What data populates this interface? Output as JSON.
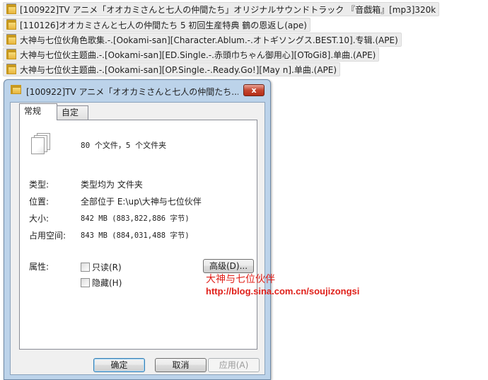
{
  "folders": [
    {
      "label": "[100922]TV アニメ「オオカミさんと七人の仲間たち」オリジナルサウンドトラック 『音戯箱』[mp3]320k"
    },
    {
      "label": "[110126]オオカミさんと七人の仲間たち 5 初回生産特典 鶴の恩返し(ape)"
    },
    {
      "label": "大神与七位伙角色歌集.-.[Ookami-san][Character.Ablum.-.オトギソングス.BEST.10].专辑.(APE)"
    },
    {
      "label": "大神与七位伙主题曲.-.[Ookami-san][ED.Single.-.赤頭巾ちゃん御用心][OToGi8].单曲.(APE)"
    },
    {
      "label": "大神与七位伙主题曲.-.[Ookami-san][OP.Single.-.Ready.Go!][May n].单曲.(APE)"
    }
  ],
  "dialog": {
    "title": "[100922]TV アニメ「オオカミさんと七人の仲間たち...",
    "close_label": "x",
    "tabs": {
      "general": "常规",
      "custom": "自定义"
    },
    "summary": "80 个文件，5 个文件夹",
    "type_label": "类型:",
    "type_value": "类型均为 文件夹",
    "location_label": "位置:",
    "location_value": "全部位于 E:\\up\\大神与七位伙伴",
    "size_label": "大小:",
    "size_value": "842 MB (883,822,886 字节)",
    "disk_label": "占用空间:",
    "disk_value": "843 MB (884,031,488 字节)",
    "attributes_label": "属性:",
    "readonly_label": "只读(R)",
    "hidden_label": "隐藏(H)",
    "advanced_button": "高级(D)...",
    "ok_button": "确定",
    "cancel_button": "取消",
    "apply_button": "应用(A)"
  },
  "watermark": {
    "title": "大神与七位伙伴",
    "url": "http://blog.sina.com.cn/soujizongsi"
  }
}
